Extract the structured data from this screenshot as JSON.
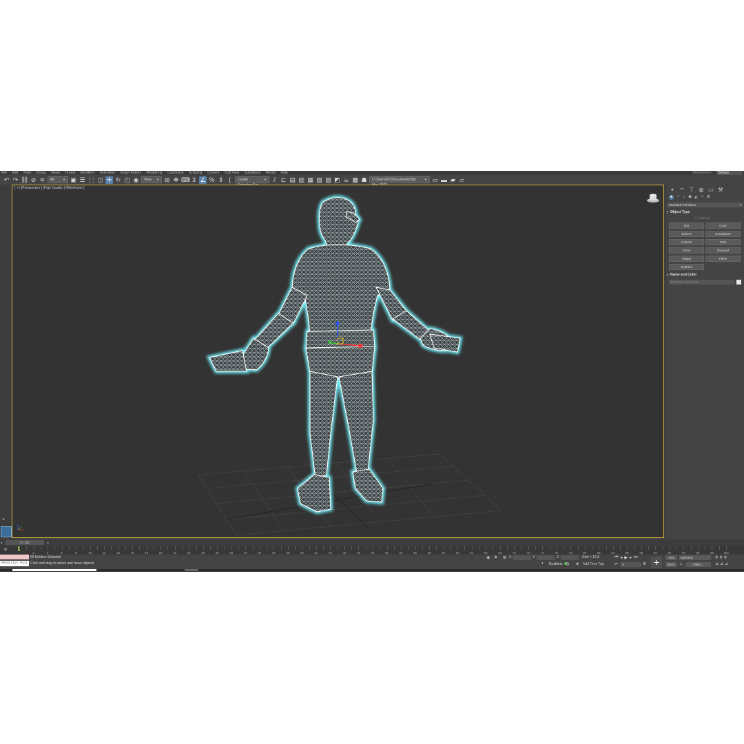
{
  "menu": [
    "File",
    "Edit",
    "Tools",
    "Group",
    "Views",
    "Create",
    "Modifiers",
    "Animation",
    "Graph Editors",
    "Rendering",
    "Customize",
    "Scripting",
    "Content",
    "Civil View",
    "Substance",
    "Arnold",
    "Help"
  ],
  "workspaces_label": "Workspaces:",
  "workspace_value": "Default",
  "toolbar": {
    "selection_filter": "All",
    "reference_coord": "View",
    "selection_set": "Create Selection Set",
    "project_path": "C:\\Users\\PC\\Documents\\3ds Max 2022"
  },
  "viewport": {
    "label": "[ + ] [Perspective ] [High Quality ] [Wireframe ]",
    "wire_color": "#ffffff",
    "selection_glow": "#6ef3ff"
  },
  "command_panel": {
    "category": "Standard Primitives",
    "object_type_title": "Object Type",
    "autogrid": "AutoGrid",
    "primitives": [
      "Box",
      "Cone",
      "Sphere",
      "GeoSphere",
      "Cylinder",
      "Tube",
      "Torus",
      "Pyramid",
      "Teapot",
      "Plane",
      "TextPlus"
    ],
    "name_color_title": "Name and Color",
    "name_field": "66 Entities Selected",
    "object_color": "#e8e8e8"
  },
  "timeline": {
    "frame_slider": "0 / 100",
    "ticks": [
      "0",
      "2",
      "6",
      "10",
      "14",
      "18",
      "22",
      "26",
      "30",
      "34",
      "38",
      "42",
      "46",
      "50",
      "54",
      "58",
      "62",
      "66",
      "70",
      "74",
      "78",
      "82",
      "86",
      "90",
      "94",
      "98",
      "4",
      "8",
      "12",
      "16",
      "20",
      "24",
      "28",
      "32",
      "36",
      "40",
      "44",
      "48",
      "52",
      "56",
      "60",
      "64",
      "68",
      "72",
      "76",
      "80",
      "84",
      "88",
      "92",
      "96",
      "100"
    ]
  },
  "status": {
    "maxscript": "MAXScript Mini",
    "selected": "66 Entities Selected",
    "prompt": "Click and drag to select and move objects",
    "x_label": "X:",
    "y_label": "Y:",
    "z_label": "Z:",
    "grid": "Grid = 10,0",
    "enabled": "Enabled:",
    "add_time_tag": "Add Time Tag",
    "auto": "Auto",
    "selected_dd": "Selected",
    "set_key": "Set K.",
    "filters": "Filters...",
    "frame": "0"
  }
}
